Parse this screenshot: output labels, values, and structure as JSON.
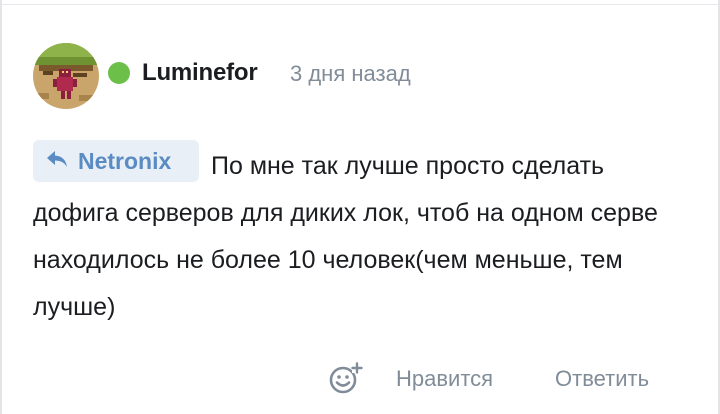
{
  "comment": {
    "author": "Luminefor",
    "time": "3 дня назад",
    "reply_to": "Netronix",
    "text": "По мне так лучше просто сделать дофига серверов для диких лок, чтоб на одном серве находилось не более 10 человек(чем меньше, тем лучше)",
    "online": true,
    "online_color": "#6cc04a"
  },
  "actions": {
    "react_icon": "emoji-add-icon",
    "like_label": "Нравится",
    "reply_label": "Ответить"
  },
  "icons": {
    "reply_chip": "reply-arrow-icon"
  },
  "colors": {
    "link_blue": "#5a8bc2",
    "chip_bg": "#e8eff7",
    "secondary_text": "#818c99"
  }
}
